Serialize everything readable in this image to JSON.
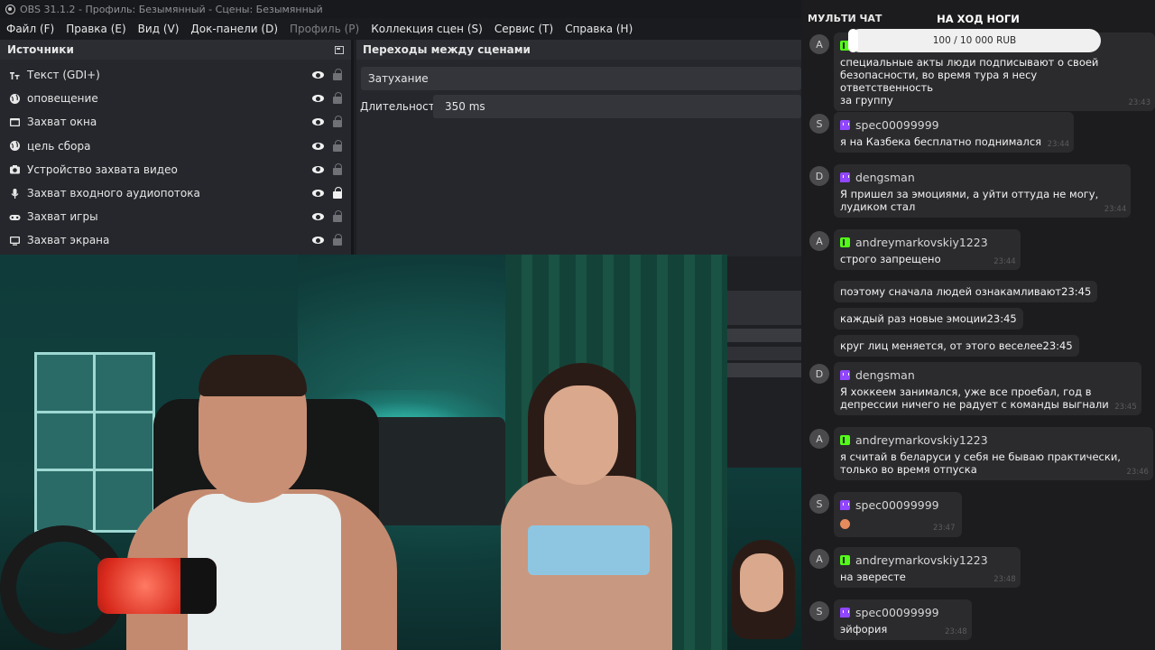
{
  "window": {
    "title": "OBS 31.1.2 - Профиль: Безымянный - Сцены: Безымянный"
  },
  "menu": [
    {
      "label": "Файл (F)",
      "enabled": true
    },
    {
      "label": "Правка (E)",
      "enabled": true
    },
    {
      "label": "Вид (V)",
      "enabled": true
    },
    {
      "label": "Док-панели (D)",
      "enabled": true
    },
    {
      "label": "Профиль (P)",
      "enabled": false
    },
    {
      "label": "Коллекция сцен (S)",
      "enabled": true
    },
    {
      "label": "Сервис (T)",
      "enabled": true
    },
    {
      "label": "Справка (H)",
      "enabled": true
    }
  ],
  "sources": {
    "title": "Источники",
    "items": [
      {
        "name": "Текст (GDI+)",
        "icon": "text-icon",
        "locked": false
      },
      {
        "name": "оповещение",
        "icon": "globe-icon",
        "locked": false
      },
      {
        "name": "Захват окна",
        "icon": "window-icon",
        "locked": false
      },
      {
        "name": "цель сбора",
        "icon": "globe-icon",
        "locked": false
      },
      {
        "name": "Устройство захвата видео",
        "icon": "camera-icon",
        "locked": false
      },
      {
        "name": "Захват входного аудиопотока",
        "icon": "microphone-icon",
        "locked": true
      },
      {
        "name": "Захват игры",
        "icon": "gamepad-icon",
        "locked": false
      },
      {
        "name": "Захват экрана",
        "icon": "monitor-icon",
        "locked": false
      }
    ]
  },
  "transitions": {
    "title": "Переходы между сценами",
    "selected": "Затухание",
    "duration_label": "Длительность",
    "duration_value": "350 ms"
  },
  "chat": {
    "title": "МУЛЬТИ ЧАТ",
    "goal_title": "НА ХОД НОГИ",
    "goal_text": "100 / 10 000 RUB",
    "goal_fraction": 0.01,
    "messages": [
      {
        "avatar": "A",
        "platform": "kick",
        "user": "",
        "lines": [
          "специальные акты люди подписывают о своей",
          "безопасности, во время тура я несу ответственность",
          "за группу"
        ],
        "time": "23:43"
      },
      {
        "avatar": "S",
        "platform": "twitch",
        "user": "spec00099999",
        "lines": [
          "я на Казбека бесплатно поднимался"
        ],
        "time": "23:44"
      },
      {
        "avatar": "D",
        "platform": "twitch",
        "user": "dengsman",
        "lines": [
          "Я пришел за эмоциями, а уйти оттуда не могу,",
          "лудиком стал"
        ],
        "time": "23:44"
      },
      {
        "avatar": "A",
        "platform": "kick",
        "user": "andreymarkovskiy1223",
        "lines": [
          "строго запрещено"
        ],
        "time": "23:44"
      },
      {
        "avatar": "",
        "platform": "",
        "user": "",
        "lines": [
          "поэтому сначала людей ознакамливают"
        ],
        "time": "23:45"
      },
      {
        "avatar": "",
        "platform": "",
        "user": "",
        "lines": [
          "каждый раз новые эмоции"
        ],
        "time": "23:45"
      },
      {
        "avatar": "",
        "platform": "",
        "user": "",
        "lines": [
          "круг лиц меняется, от этого веселее"
        ],
        "time": "23:45"
      },
      {
        "avatar": "D",
        "platform": "twitch",
        "user": "dengsman",
        "lines": [
          "Я хоккеем занимался, уже все проебал, год в",
          "депрессии ничего не радует с команды выгнали"
        ],
        "time": "23:45"
      },
      {
        "avatar": "A",
        "platform": "kick",
        "user": "andreymarkovskiy1223",
        "lines": [
          "я считай в беларуси у себя не бываю практически,",
          "только во время отпуска"
        ],
        "time": "23:46"
      },
      {
        "avatar": "S",
        "platform": "twitch",
        "user": "spec00099999",
        "lines": [
          ""
        ],
        "time": "23:47",
        "emoji": true
      },
      {
        "avatar": "A",
        "platform": "kick",
        "user": "andreymarkovskiy1223",
        "lines": [
          "на эвересте"
        ],
        "time": "23:48"
      },
      {
        "avatar": "S",
        "platform": "twitch",
        "user": "spec00099999",
        "lines": [
          "эйфория"
        ],
        "time": "23:48"
      }
    ]
  }
}
